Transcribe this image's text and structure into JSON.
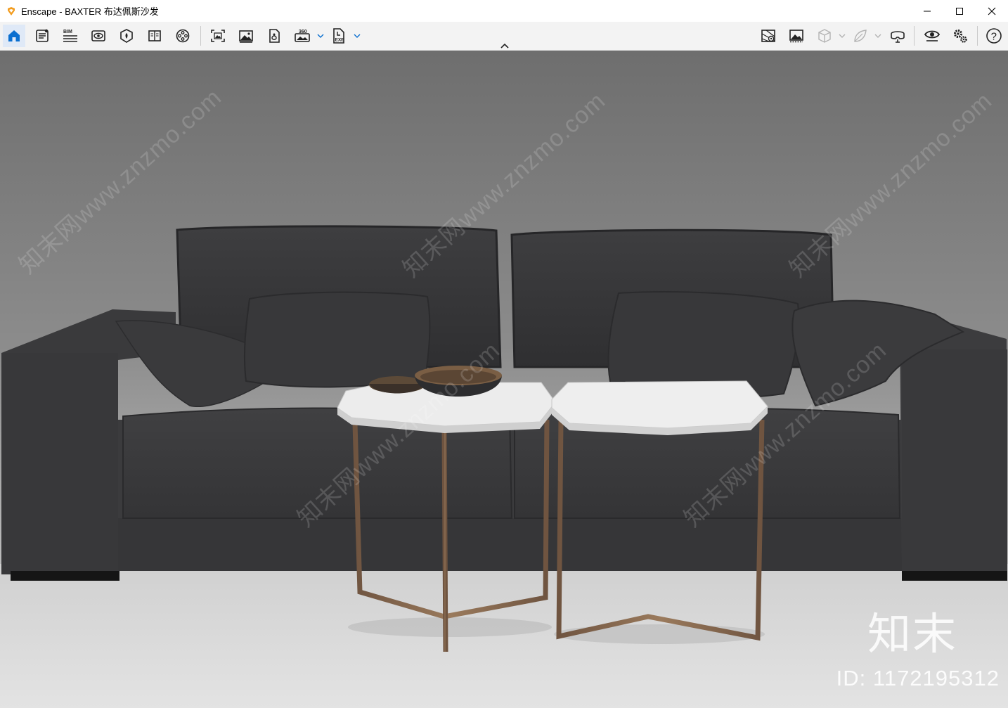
{
  "window": {
    "title": "Enscape - BAXTER 布达佩斯沙发",
    "controls": [
      "minimize-icon",
      "maximize-icon",
      "close-icon"
    ]
  },
  "toolbar": {
    "left_icons": [
      "home-icon",
      "document-list-icon",
      "bim-icon",
      "view-eye-icon",
      "asset-library-icon",
      "book-icon",
      "video-reel-icon",
      "screenshot-icon",
      "image-icon",
      "panorama-icon",
      "panorama-360-icon",
      "exe-export-icon"
    ],
    "bim_label": "BIM",
    "pano_label": "360",
    "exe_label": "EXE",
    "right_icons": [
      "map-view-icon",
      "render-image-icon",
      "cube-icon",
      "leaf-icon",
      "vr-headset-icon",
      "visual-settings-icon",
      "settings-gears-icon",
      "help-icon"
    ],
    "help_label": "?"
  },
  "viewport": {
    "watermark_text": "知末网www.znzmo.com",
    "brand_text": "知末",
    "id_text": "ID: 1172195312"
  },
  "colors": {
    "accent": "#0a6fd0",
    "logo": "#f29b1d",
    "background_top": "#6e6e6e",
    "floor": "#dcdcdc",
    "sofa": "#3a3a3c",
    "table_frame": "#8a6a4e",
    "marble": "#ececec"
  }
}
